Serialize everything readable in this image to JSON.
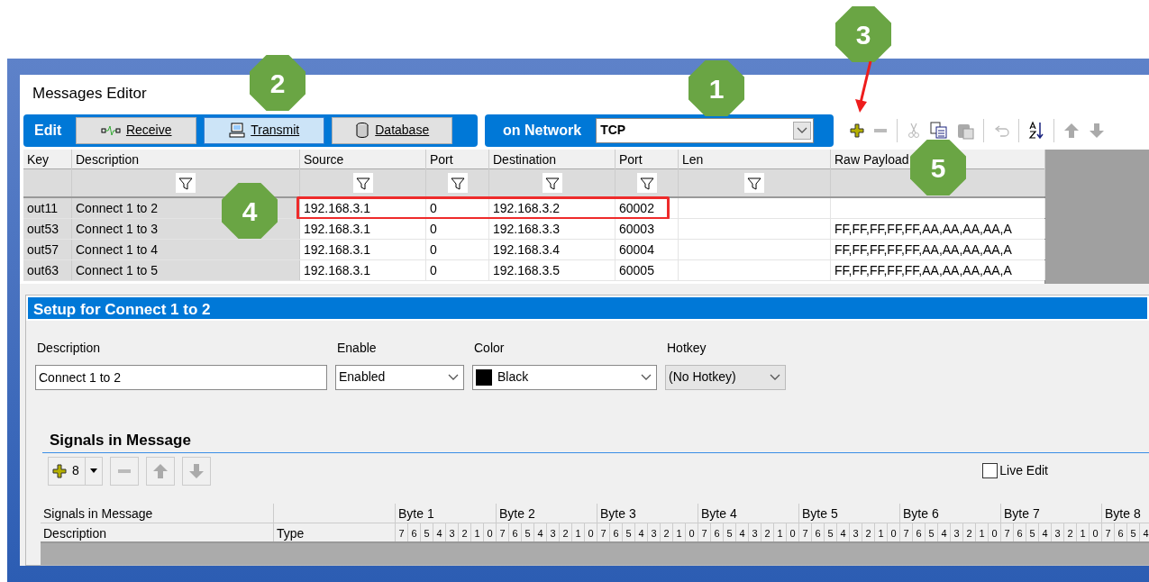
{
  "window": {
    "title": "Messages Editor"
  },
  "mode_bar": {
    "label": "Edit",
    "tabs": [
      {
        "label": "Receive",
        "kind": "receive",
        "selected": false
      },
      {
        "label": "Transmit",
        "kind": "transmit",
        "selected": true
      },
      {
        "label": "Database",
        "kind": "database",
        "selected": false
      }
    ]
  },
  "network": {
    "label": "on Network",
    "value": "TCP"
  },
  "toolbar": [
    {
      "kind": "add",
      "disabled": false
    },
    {
      "kind": "remove",
      "disabled": true
    },
    {
      "kind": "cut",
      "disabled": true
    },
    {
      "kind": "copy",
      "disabled": false
    },
    {
      "kind": "paste",
      "disabled": true
    },
    {
      "kind": "undo",
      "disabled": true
    },
    {
      "kind": "sort",
      "disabled": false
    },
    {
      "kind": "up",
      "disabled": true
    },
    {
      "kind": "down",
      "disabled": true
    }
  ],
  "table": {
    "columns": [
      {
        "label": "Key"
      },
      {
        "label": "Description"
      },
      {
        "label": "Source"
      },
      {
        "label": "Port"
      },
      {
        "label": "Destination"
      },
      {
        "label": "Port"
      },
      {
        "label": "Len"
      },
      {
        "label": "Raw Payload"
      }
    ],
    "filter_row": [
      {
        "kind": "blank"
      },
      {
        "kind": "filter"
      },
      {
        "kind": "filter"
      },
      {
        "kind": "filter"
      },
      {
        "kind": "filter"
      },
      {
        "kind": "filter"
      },
      {
        "kind": "filter"
      },
      {
        "kind": "blank"
      }
    ],
    "rows": [
      {
        "key": "out11",
        "description": "Connect 1 to 2",
        "source": "192.168.3.1",
        "source_port": "0",
        "destination": "192.168.3.2",
        "destination_port": "60002",
        "highlighted": true
      },
      {
        "key": "out53",
        "description": "Connect 1 to 3",
        "source": "192.168.3.1",
        "source_port": "0",
        "destination": "192.168.3.3",
        "destination_port": "60003",
        "raw_payload": "FF,FF,FF,FF,FF,AA,AA,AA,AA,A",
        "highlighted": false
      },
      {
        "key": "out57",
        "description": "Connect 1 to 4",
        "source": "192.168.3.1",
        "source_port": "0",
        "destination": "192.168.3.4",
        "destination_port": "60004",
        "raw_payload": "FF,FF,FF,FF,FF,AA,AA,AA,AA,A",
        "highlighted": false
      },
      {
        "key": "out63",
        "description": "Connect 1 to 5",
        "source": "192.168.3.1",
        "source_port": "0",
        "destination": "192.168.3.5",
        "destination_port": "60005",
        "raw_payload": "FF,FF,FF,FF,FF,AA,AA,AA,AA,A",
        "highlighted": false
      }
    ]
  },
  "setup": {
    "title": "Setup for Connect 1 to 2",
    "fields": [
      {
        "label": "Description",
        "kind": "text",
        "value": "Connect 1 to 2"
      },
      {
        "label": "Enable",
        "kind": "select",
        "value": "Enabled",
        "disabled": false
      },
      {
        "label": "Color",
        "kind": "color",
        "value": "Black",
        "color": "#000000",
        "disabled": false
      },
      {
        "label": "Hotkey",
        "kind": "select",
        "value": "(No Hotkey)",
        "disabled": true
      }
    ]
  },
  "signals": {
    "title": "Signals in Message",
    "add_count": "8",
    "live_edit": {
      "label": "Live Edit",
      "checked": false
    },
    "grid": {
      "header_1": "Signals in Message",
      "header_2": "Description",
      "header_type": "Type",
      "bytes": [
        {
          "label": "Byte 1",
          "bits": [
            "7",
            "6",
            "5",
            "4",
            "3",
            "2",
            "1",
            "0"
          ]
        },
        {
          "label": "Byte 2",
          "bits": [
            "7",
            "6",
            "5",
            "4",
            "3",
            "2",
            "1",
            "0"
          ]
        },
        {
          "label": "Byte 3",
          "bits": [
            "7",
            "6",
            "5",
            "4",
            "3",
            "2",
            "1",
            "0"
          ]
        },
        {
          "label": "Byte 4",
          "bits": [
            "7",
            "6",
            "5",
            "4",
            "3",
            "2",
            "1",
            "0"
          ]
        },
        {
          "label": "Byte 5",
          "bits": [
            "7",
            "6",
            "5",
            "4",
            "3",
            "2",
            "1",
            "0"
          ]
        },
        {
          "label": "Byte 6",
          "bits": [
            "7",
            "6",
            "5",
            "4",
            "3",
            "2",
            "1",
            "0"
          ]
        },
        {
          "label": "Byte 7",
          "bits": [
            "7",
            "6",
            "5",
            "4",
            "3",
            "2",
            "1",
            "0"
          ]
        },
        {
          "label": "Byte 8",
          "bits": [
            "7",
            "6",
            "5",
            "4"
          ]
        }
      ]
    }
  },
  "callouts": [
    {
      "label": "1"
    },
    {
      "label": "2"
    },
    {
      "label": "3"
    },
    {
      "label": "4"
    },
    {
      "label": "5"
    }
  ]
}
